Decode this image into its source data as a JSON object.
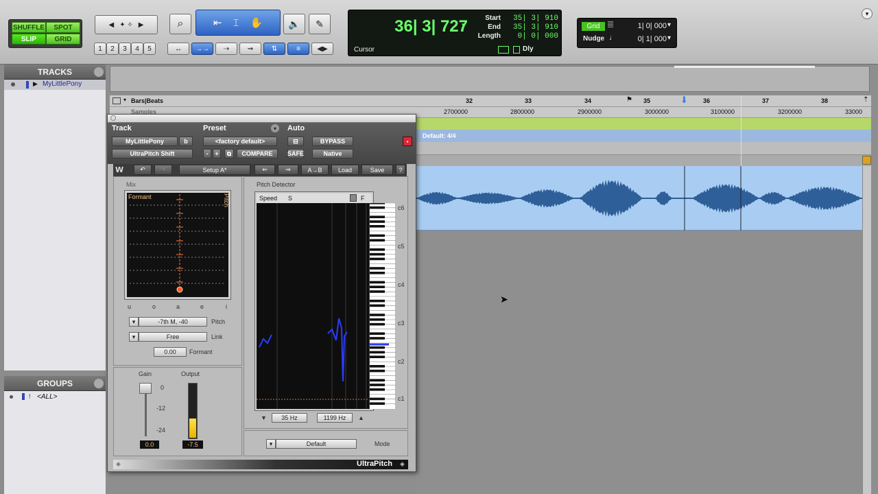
{
  "modes": {
    "shuffle": "SHUFFLE",
    "spot": "SPOT",
    "slip": "SLIP",
    "grid": "GRID"
  },
  "zoom_presets": [
    "1",
    "2",
    "3",
    "4",
    "5"
  ],
  "counter": {
    "main": "36| 3| 727",
    "cursor_label": "Cursor",
    "start_label": "Start",
    "start": "35| 3| 910",
    "end_label": "End",
    "end": "35| 3| 910",
    "length_label": "Length",
    "length": "0| 0| 000",
    "dly_label": "Dly"
  },
  "grid": {
    "label": "Grid",
    "value": "1| 0| 000",
    "nudge_label": "Nudge",
    "nudge_value": "0| 1| 000"
  },
  "tracks_pane": {
    "title": "TRACKS",
    "items": [
      {
        "name": "MyLittlePony"
      }
    ]
  },
  "groups_pane": {
    "title": "GROUPS",
    "items": [
      {
        "name": "<ALL>"
      }
    ]
  },
  "rulers": {
    "bars_label": "Bars|Beats",
    "samples_label": "Samples",
    "bars": [
      "32",
      "33",
      "34",
      "35",
      "36",
      "37",
      "38"
    ],
    "samples": [
      "2700000",
      "2800000",
      "2900000",
      "3000000",
      "3100000",
      "3200000",
      "33000"
    ],
    "meter": "Default: 4/4"
  },
  "plugin": {
    "track_label": "Track",
    "preset_label": "Preset",
    "auto_label": "Auto",
    "track_name": "MyLittlePony",
    "track_b": "b",
    "insert": "UltraPitch Shift",
    "preset_value": "<factory default>",
    "compare": "COMPARE",
    "bypass": "BYPASS",
    "safe": "SAFE",
    "native": "Native",
    "minus": "-",
    "plus": "+",
    "setup": "Setup A*",
    "ab": "A→B",
    "load": "Load",
    "save": "Save",
    "help": "?",
    "mix_label": "Mix",
    "formant_label": "Formant",
    "pitch_axis": "Pitch",
    "vowels": [
      "u",
      "o",
      "a",
      "e",
      "i"
    ],
    "pitch_value": "-7th M, -40",
    "pitch_label": "Pitch",
    "link_value": "Free",
    "link_label": "Link",
    "formant_value": "0.00",
    "formant_field_label": "Formant",
    "gain_label": "Gain",
    "output_label": "Output",
    "gain_ticks": [
      "0",
      "-12",
      "-24"
    ],
    "gain_value": "0.0",
    "output_value": "-7.5",
    "output_level": 0.35,
    "detector_label": "Pitch Detector",
    "speed_label": "Speed",
    "speed_s": "S",
    "speed_f": "F",
    "notes": [
      "c6",
      "c5",
      "c4",
      "c3",
      "c2",
      "c1"
    ],
    "low_hz": "35 Hz",
    "high_hz": "1199 Hz",
    "mode_value": "Default",
    "mode_label": "Mode",
    "brand": "UltraPitch"
  }
}
